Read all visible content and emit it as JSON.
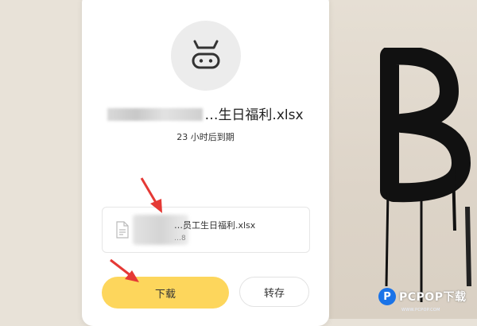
{
  "file": {
    "title": "…生日福利.xlsx",
    "expiry": "23 小时后到期",
    "row_name": "…员工生日福利.xlsx",
    "row_sub": "…8"
  },
  "buttons": {
    "download": "下载",
    "save": "转存"
  },
  "watermark": {
    "text": "PCPOP下载",
    "sub": "WWW.PCPOP.COM",
    "circle_letter": "P"
  },
  "colors": {
    "download_button": "#fdd65c",
    "arrow": "#e53935",
    "watermark_blue": "#1a73e8"
  },
  "icons": [
    "cow-logo-icon",
    "file-icon",
    "annotation-arrow-icon"
  ]
}
